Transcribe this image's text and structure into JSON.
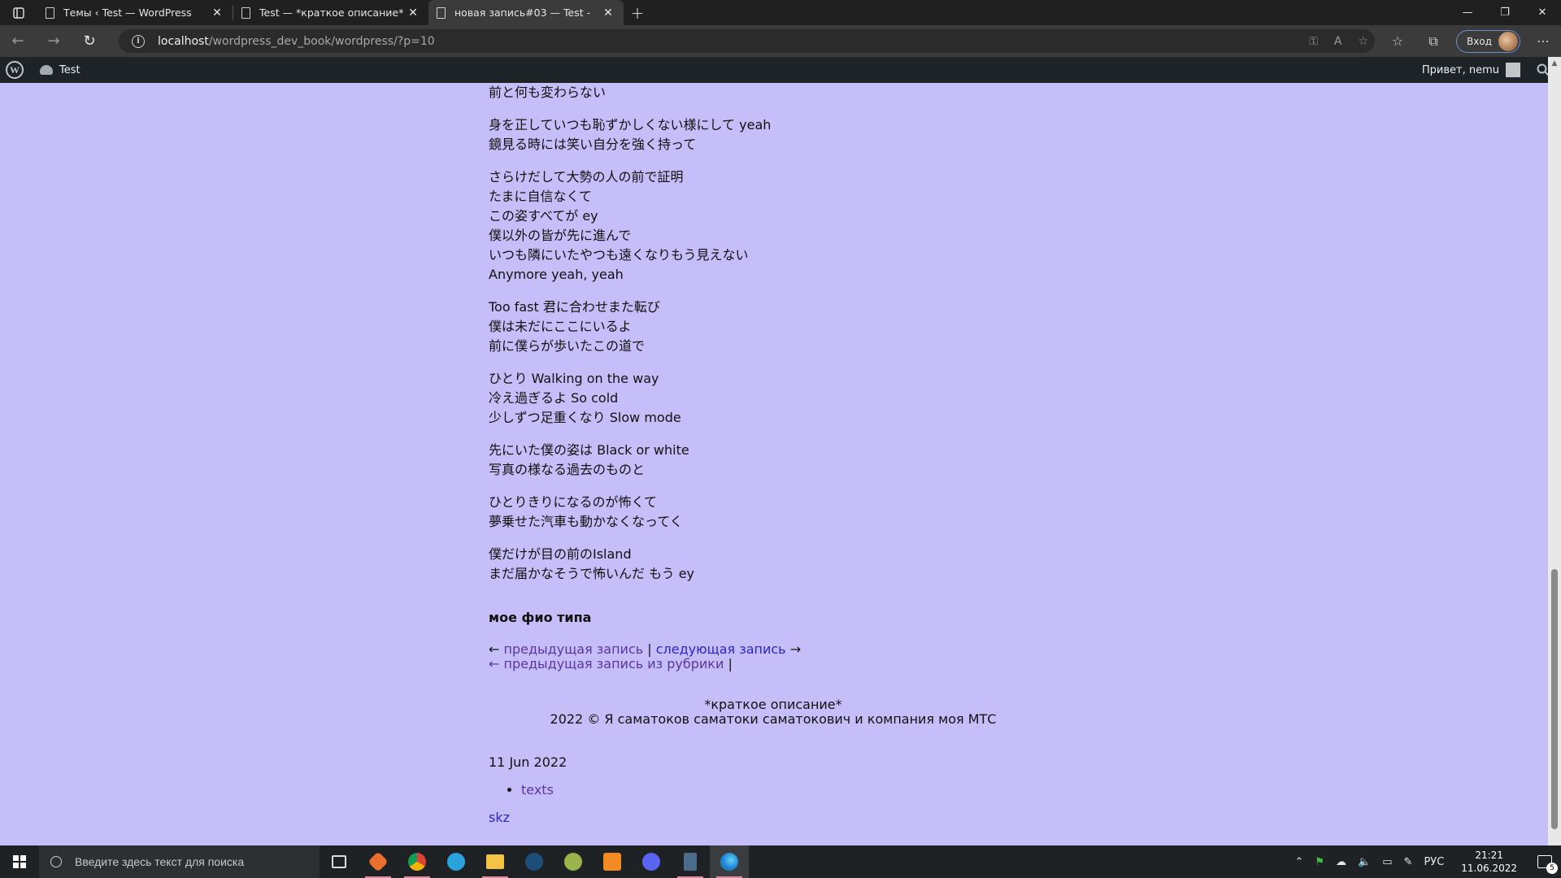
{
  "browser": {
    "tabs": [
      {
        "title": "Темы ‹ Test — WordPress",
        "active": false
      },
      {
        "title": "Test — *краткое описание* -",
        "active": false
      },
      {
        "title": "новая запись#03 — Test -",
        "active": true
      }
    ],
    "url_host": "localhost",
    "url_path": "/wordpress_dev_book/wordpress/?p=10",
    "login_label": "Вход"
  },
  "adminbar": {
    "logo": "W",
    "site_name": "Test",
    "greeting": "Привет, nemu"
  },
  "post": {
    "stanzas": [
      [
        "前と何も変わらない"
      ],
      [
        "身を正していつも恥ずかしくない様にして yeah",
        "鏡見る時には笑い自分を強く持って"
      ],
      [
        "さらけだして大勢の人の前で証明",
        "たまに自信なくて",
        "この姿すべてが ey",
        "僕以外の皆が先に進んで",
        "いつも隣にいたやつも遠くなりもう見えない",
        "Anymore yeah, yeah"
      ],
      [
        "Too fast 君に合わせまた転び",
        "僕は未だにここにいるよ",
        "前に僕らが歩いたこの道で"
      ],
      [
        "ひとり Walking on the way",
        "冷え過ぎるよ So cold",
        "少しずつ足重くなり Slow mode"
      ],
      [
        "先にいた僕の姿は Black or white",
        "写真の様なる過去のものと"
      ],
      [
        "ひとりきりになるのが怖くて",
        "夢乗せた汽車も動かなくなってく"
      ],
      [
        "僕だけが目の前のIsland",
        "まだ届かなそうで怖いんだ もう ey"
      ]
    ],
    "signature": "мое фио типа",
    "prev_arrow": "←",
    "prev_link": "предыдущая запись",
    "separator": "|",
    "next_link": "следующая запись",
    "next_arrow": "→",
    "prev_cat_link": "← предыдущая запись из рубрики",
    "prev_cat_sep": "|"
  },
  "footer": {
    "description": "*краткое описание*",
    "copyright": "2022 © Я саматоков саматоки саматокович и компания моя МТС"
  },
  "sidebar": {
    "date": "11 Jun 2022",
    "categories": [
      "texts"
    ],
    "tag_link": "skz"
  },
  "taskbar": {
    "search_placeholder": "Введите здесь текст для поиска",
    "language": "РУС",
    "time": "21:21",
    "date": "11.06.2022",
    "notifications": "5"
  }
}
